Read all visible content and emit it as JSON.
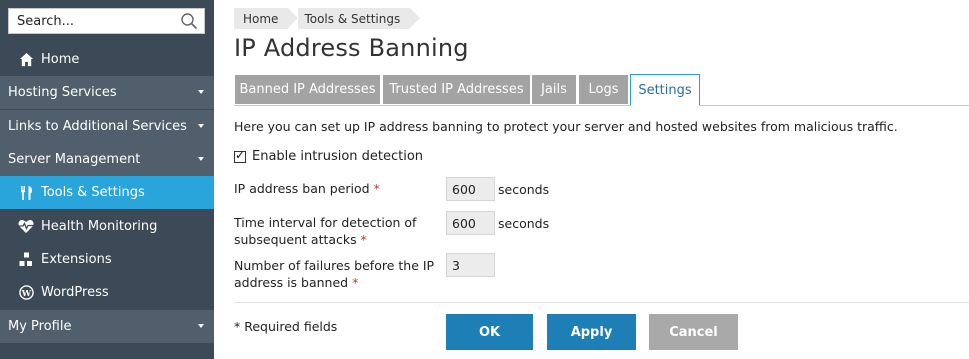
{
  "sidebar": {
    "search_placeholder": "Search...",
    "items": [
      {
        "label": "Home"
      },
      {
        "label": "Hosting Services"
      },
      {
        "label": "Links to Additional Services"
      },
      {
        "label": "Server Management"
      },
      {
        "label": "Tools & Settings"
      },
      {
        "label": "Health Monitoring"
      },
      {
        "label": "Extensions"
      },
      {
        "label": "WordPress"
      },
      {
        "label": "My Profile"
      }
    ],
    "active_item": "Tools & Settings",
    "colors": {
      "background": "#3b4a56",
      "section": "#505f6b",
      "active": "#29a5dc"
    }
  },
  "breadcrumb": [
    "Home",
    "Tools & Settings"
  ],
  "page_title": "IP Address Banning",
  "tabs": [
    {
      "label": "Banned IP Addresses",
      "active": false
    },
    {
      "label": "Trusted IP Addresses",
      "active": false
    },
    {
      "label": "Jails",
      "active": false
    },
    {
      "label": "Logs",
      "active": false
    },
    {
      "label": "Settings",
      "active": true
    }
  ],
  "intro": "Here you can set up IP address banning to protect your server and hosted websites from malicious traffic.",
  "form": {
    "enable_intrusion_detection": {
      "label": "Enable intrusion detection",
      "checked": true
    },
    "ban_period": {
      "label": "IP address ban period",
      "required_mark": "*",
      "value": "600",
      "unit": "seconds"
    },
    "detection_interval": {
      "label_line1": "Time interval for detection of",
      "label_line2": "subsequent attacks",
      "required_mark": "*",
      "value": "600",
      "unit": "seconds"
    },
    "failures": {
      "label_line1": "Number of failures before the IP",
      "label_line2": "address is banned",
      "required_mark": "*",
      "value": "3"
    },
    "required_note": "* Required fields"
  },
  "buttons": {
    "ok": "OK",
    "apply": "Apply",
    "cancel": "Cancel"
  }
}
